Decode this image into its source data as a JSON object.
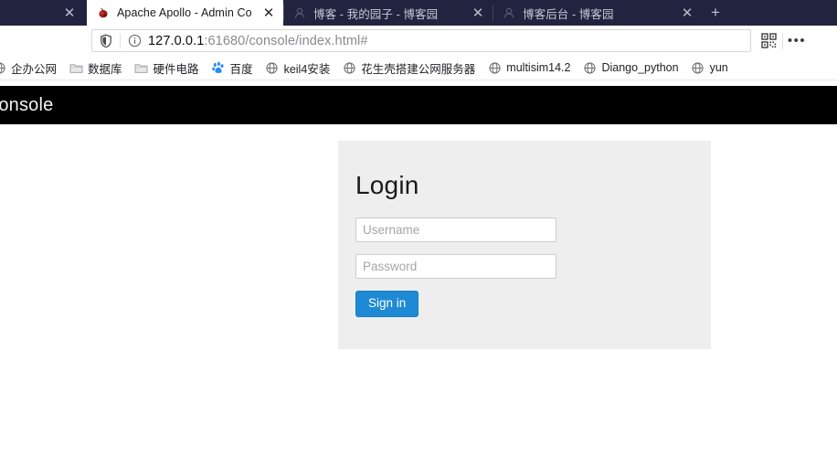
{
  "browser": {
    "tabs": [
      {
        "title": "",
        "favicon": "none-icon",
        "active": false,
        "cutoff": true
      },
      {
        "title": "Apache Apollo - Admin Con",
        "favicon": "apollo-icon",
        "active": true,
        "cutoff": false
      },
      {
        "title": "博客 - 我的园子 - 博客园",
        "favicon": "cnblogs-icon",
        "active": false,
        "cutoff": false
      },
      {
        "title": "博客后台 - 博客园",
        "favicon": "cnblogs-icon",
        "active": false,
        "cutoff": false
      }
    ],
    "new_tab_label": "+",
    "close_label": "✕",
    "address_bar": {
      "host": "127.0.0.1",
      "path": ":61680/console/index.html#",
      "full_url": "127.0.0.1:61680/console/index.html#",
      "shield_icon": "shield-icon",
      "info_icon": "info-icon"
    },
    "toolbar_right": {
      "qr_icon": "qr-code-icon",
      "menu_label": "•••"
    },
    "bookmarks": [
      {
        "label": "企办公网",
        "icon": "globe-icon"
      },
      {
        "label": "数据库",
        "icon": "folder-icon"
      },
      {
        "label": "硬件电路",
        "icon": "folder-icon"
      },
      {
        "label": "百度",
        "icon": "baidu-icon"
      },
      {
        "label": "keil4安装",
        "icon": "globe-icon"
      },
      {
        "label": "花生壳搭建公网服务器",
        "icon": "globe-icon"
      },
      {
        "label": "multisim14.2",
        "icon": "globe-icon"
      },
      {
        "label": "Diango_python",
        "icon": "globe-icon"
      },
      {
        "label": "yun",
        "icon": "globe-icon"
      }
    ]
  },
  "app": {
    "brand": "ollo Console",
    "navbar_color": "#000000",
    "login": {
      "title": "Login",
      "username_placeholder": "Username",
      "username_value": "",
      "password_placeholder": "Password",
      "password_value": "",
      "signin_label": "Sign in",
      "signin_color": "#1e8ad6",
      "panel_color": "#eeeeee"
    }
  }
}
